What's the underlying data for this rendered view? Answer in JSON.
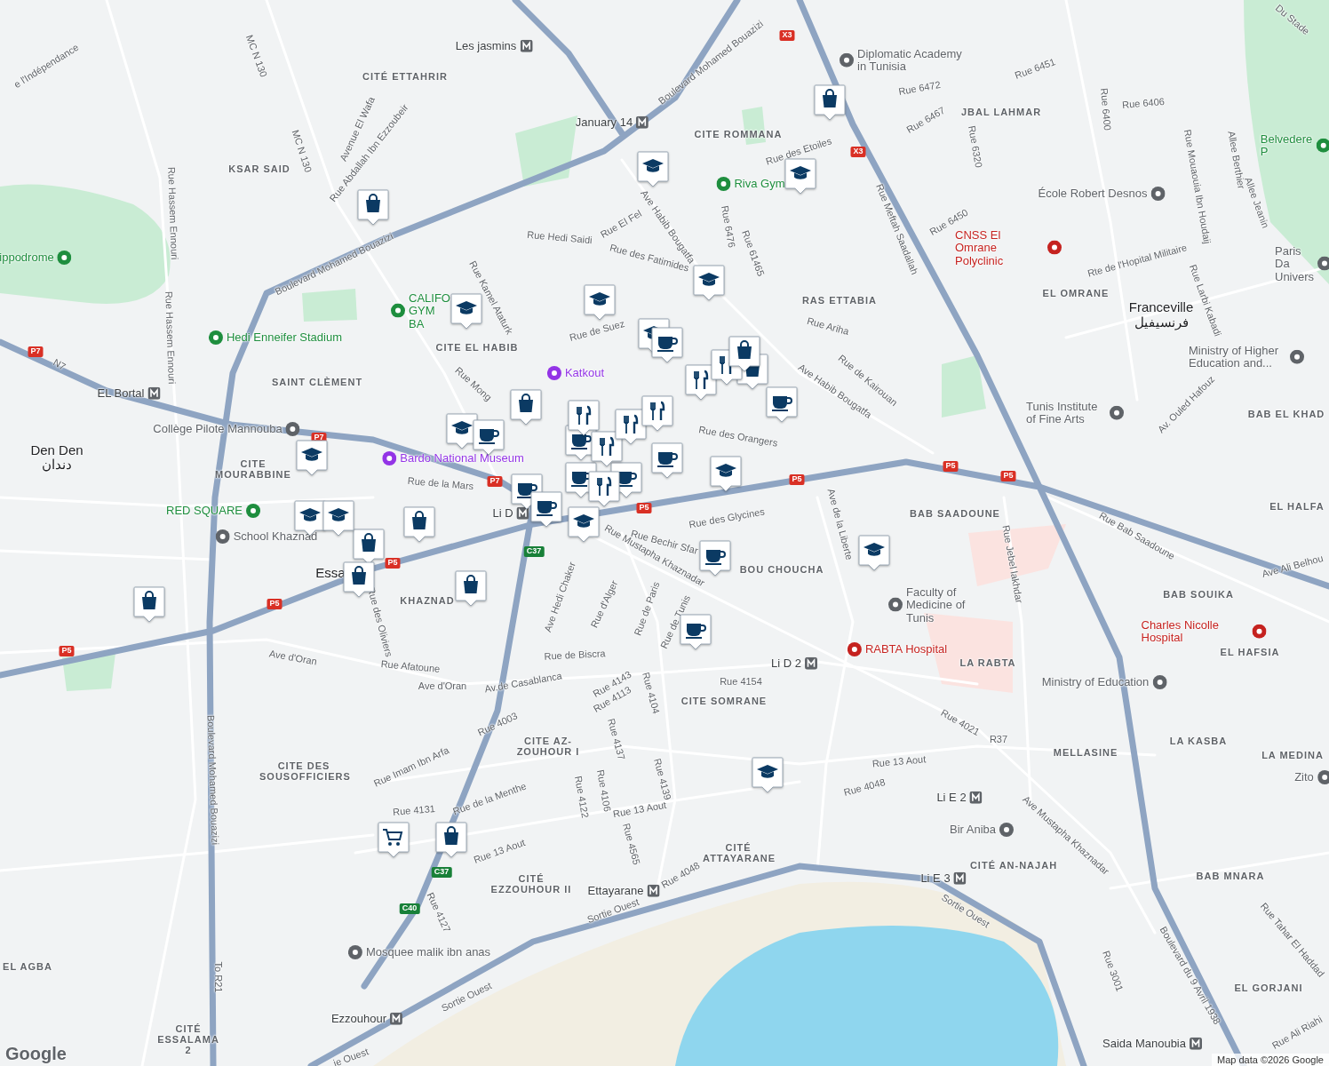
{
  "map": {
    "labels": [
      {
        "text": "Les jasmins",
        "kind": "transit"
      },
      {
        "text": "CITÉ ETTAHRIR",
        "kind": "area"
      },
      {
        "text": "KSAR SAID",
        "kind": "area"
      },
      {
        "text": "January 14",
        "kind": "transit"
      },
      {
        "text": "Diplomatic Academy in Tunisia",
        "kind": "poi",
        "color": "#5f6368"
      },
      {
        "text": "CITE ROMMANA",
        "kind": "area"
      },
      {
        "text": "JBAL LAHMAR",
        "kind": "area"
      },
      {
        "text": "Riva Gym",
        "kind": "poi",
        "color": "#1e8e3e"
      },
      {
        "text": "École Robert Desnos",
        "kind": "poi",
        "color": "#5f6368"
      },
      {
        "text": "CNSS El Omrane Polyclinic",
        "kind": "poi",
        "color": "#c5221f"
      },
      {
        "text": "Belvedere P",
        "kind": "poi",
        "color": "#1e8e3e"
      },
      {
        "text": "ippodrome",
        "kind": "poi",
        "color": "#1e8e3e"
      },
      {
        "text": "Paris Da Univers",
        "kind": "poi",
        "color": "#5f6368"
      },
      {
        "text": "CALIFO GYM BA",
        "kind": "poi",
        "color": "#1e8e3e"
      },
      {
        "text": "Hedi Enneifer Stadium",
        "kind": "poi",
        "color": "#1e8e3e"
      },
      {
        "text": "RAS ETTABIA",
        "kind": "area"
      },
      {
        "text": "EL OMRANE",
        "kind": "area"
      },
      {
        "text": "Franceville",
        "kind": "place"
      },
      {
        "text": "فرنسيفيل",
        "kind": "place"
      },
      {
        "text": "CITE EL HABIB",
        "kind": "area"
      },
      {
        "text": "Katkout",
        "kind": "poi",
        "color": "#9334e6"
      },
      {
        "text": "SAINT CLÈMENT",
        "kind": "area"
      },
      {
        "text": "EL Bortal",
        "kind": "transit"
      },
      {
        "text": "Ministry of Higher Education and...",
        "kind": "poi",
        "color": "#5f6368"
      },
      {
        "text": "Tunis Institute of Fine Arts",
        "kind": "poi",
        "color": "#5f6368"
      },
      {
        "text": "BAB EL KHAD",
        "kind": "area"
      },
      {
        "text": "Collège Pilote Mannouba",
        "kind": "poi",
        "color": "#5f6368"
      },
      {
        "text": "Den Den",
        "kind": "place"
      },
      {
        "text": "دندان",
        "kind": "place"
      },
      {
        "text": "CITE MOURABBINE",
        "kind": "area"
      },
      {
        "text": "Bardo National Museum",
        "kind": "poi",
        "color": "#9334e6"
      },
      {
        "text": "RED SQUARE",
        "kind": "poi",
        "color": "#1e8e3e"
      },
      {
        "text": "Li D",
        "kind": "transit"
      },
      {
        "text": "School Khaznad",
        "kind": "poi",
        "color": "#5f6368"
      },
      {
        "text": "BAB SAADOUNE",
        "kind": "area"
      },
      {
        "text": "EL HALFA",
        "kind": "area"
      },
      {
        "text": "BOU CHOUCHA",
        "kind": "area"
      },
      {
        "text": "KHAZNAD",
        "kind": "area"
      },
      {
        "text": "BAB SOUIKA",
        "kind": "area"
      },
      {
        "text": "Faculty of Medicine of Tunis",
        "kind": "poi",
        "color": "#5f6368"
      },
      {
        "text": "Charles Nicolle Hospital",
        "kind": "poi",
        "color": "#c5221f"
      },
      {
        "text": "RABTA Hospital",
        "kind": "poi",
        "color": "#c5221f"
      },
      {
        "text": "EL HAFSIA",
        "kind": "area"
      },
      {
        "text": "LA RABTA",
        "kind": "area"
      },
      {
        "text": "Li D 2",
        "kind": "transit"
      },
      {
        "text": "Ministry of Education",
        "kind": "poi",
        "color": "#5f6368"
      },
      {
        "text": "CITE SOMRANE",
        "kind": "area"
      },
      {
        "text": "CITE AZ-ZOUHOUR I",
        "kind": "area"
      },
      {
        "text": "LA KASBA",
        "kind": "area"
      },
      {
        "text": "MELLASINE",
        "kind": "area"
      },
      {
        "text": "LA MEDINA",
        "kind": "area"
      },
      {
        "text": "CITE DES SOUSOFFICIERS",
        "kind": "area"
      },
      {
        "text": "Zito",
        "kind": "poi",
        "color": "#5f6368"
      },
      {
        "text": "Li E 2",
        "kind": "transit"
      },
      {
        "text": "Bir Aniba",
        "kind": "poi",
        "color": "#5f6368"
      },
      {
        "text": "CITÉ EZZOUHOUR II",
        "kind": "area"
      },
      {
        "text": "Ettayarane",
        "kind": "transit"
      },
      {
        "text": "CITÉ ATTAYARANE",
        "kind": "area"
      },
      {
        "text": "Li E 3",
        "kind": "transit"
      },
      {
        "text": "CITÉ AN-NAJAH",
        "kind": "area"
      },
      {
        "text": "BAB MNARA",
        "kind": "area"
      },
      {
        "text": "Mosquee malik ibn anas",
        "kind": "poi",
        "color": "#5f6368"
      },
      {
        "text": "EL AGBA",
        "kind": "area"
      },
      {
        "text": "EL GORJANI",
        "kind": "area"
      },
      {
        "text": "Ezzouhour",
        "kind": "transit"
      },
      {
        "text": "CITÉ ESSALAMA 2",
        "kind": "area"
      },
      {
        "text": "Saida Manoubia",
        "kind": "transit"
      },
      {
        "text": "Boulevard Mohamed Bouazizi",
        "kind": "street"
      },
      {
        "text": "Boulevard Mohamed Bouazizi",
        "kind": "street"
      },
      {
        "text": "Boulevard Mohamed Bouazizi",
        "kind": "street"
      },
      {
        "text": "MC N 130",
        "kind": "street"
      },
      {
        "text": "MC N 130",
        "kind": "street"
      },
      {
        "text": "e l'Indépendance",
        "kind": "street"
      },
      {
        "text": "Rue Abdallah Ibn Ezzoubeir",
        "kind": "street"
      },
      {
        "text": "Avenue El Wafa",
        "kind": "street"
      },
      {
        "text": "Rue Hassem Ennouri",
        "kind": "street"
      },
      {
        "text": "Rue Hassem Ennouri",
        "kind": "street"
      },
      {
        "text": "Rue Hedi Saidi",
        "kind": "street"
      },
      {
        "text": "Rue El Fel",
        "kind": "street"
      },
      {
        "text": "Ave Habib Bougatfa",
        "kind": "street"
      },
      {
        "text": "Rue des Fatimides",
        "kind": "street"
      },
      {
        "text": "Rue Kamel Ataturk",
        "kind": "street"
      },
      {
        "text": "Rue de Suez",
        "kind": "street"
      },
      {
        "text": "Rue des Etoiles",
        "kind": "street"
      },
      {
        "text": "Rue Meftah Saadallah",
        "kind": "street"
      },
      {
        "text": "Rue 6476",
        "kind": "street"
      },
      {
        "text": "Rue 61465",
        "kind": "street"
      },
      {
        "text": "Rue Ariha",
        "kind": "street"
      },
      {
        "text": "Ave Habib Bougatfa",
        "kind": "street"
      },
      {
        "text": "Rue de Kairouan",
        "kind": "street"
      },
      {
        "text": "Rue des Orangers",
        "kind": "street"
      },
      {
        "text": "Rue Mong",
        "kind": "street"
      },
      {
        "text": "Rue de la Mars",
        "kind": "street"
      },
      {
        "text": "Rue des Glycines",
        "kind": "street"
      },
      {
        "text": "Rue Bechir Sfar",
        "kind": "street"
      },
      {
        "text": "Rue Mustapha Khaznadar",
        "kind": "street"
      },
      {
        "text": "Ave de la Liberte",
        "kind": "street"
      },
      {
        "text": "Ave Hedi Chaker",
        "kind": "street"
      },
      {
        "text": "Rue d'Alger",
        "kind": "street"
      },
      {
        "text": "Rue de Paris",
        "kind": "street"
      },
      {
        "text": "Rue de Tunis",
        "kind": "street"
      },
      {
        "text": "Rue Jebel lakhdar",
        "kind": "street"
      },
      {
        "text": "Rue Bab Saadoune",
        "kind": "street"
      },
      {
        "text": "Av. Ouled Hafouz",
        "kind": "street"
      },
      {
        "text": "Ave Ali Belhou",
        "kind": "street"
      },
      {
        "text": "Rue 6472",
        "kind": "street"
      },
      {
        "text": "Rue 6467",
        "kind": "street"
      },
      {
        "text": "Rue 6451",
        "kind": "street"
      },
      {
        "text": "Rue 6406",
        "kind": "street"
      },
      {
        "text": "Rue 6400",
        "kind": "street"
      },
      {
        "text": "Rue 6320",
        "kind": "street"
      },
      {
        "text": "Rue 6450",
        "kind": "street"
      },
      {
        "text": "Rte de l'Hopital Militaire",
        "kind": "street"
      },
      {
        "text": "Rue Mouaouia Ibn Houdaij",
        "kind": "street"
      },
      {
        "text": "Rue Larbi Kabadi",
        "kind": "street"
      },
      {
        "text": "Allee Berthier",
        "kind": "street"
      },
      {
        "text": "Allee Jeanin",
        "kind": "street"
      },
      {
        "text": "Du Stade",
        "kind": "street"
      },
      {
        "text": "Ave d'Oran",
        "kind": "street"
      },
      {
        "text": "Ave d'Oran",
        "kind": "street"
      },
      {
        "text": "Rue Afatoune",
        "kind": "street"
      },
      {
        "text": "Av.de Casablanca",
        "kind": "street"
      },
      {
        "text": "Rue de Biscra",
        "kind": "street"
      },
      {
        "text": "Rue des Oliviers",
        "kind": "street"
      },
      {
        "text": "Rue 4154",
        "kind": "street"
      },
      {
        "text": "Rue 4143",
        "kind": "street"
      },
      {
        "text": "Rue 4113",
        "kind": "street"
      },
      {
        "text": "Rue 4104",
        "kind": "street"
      },
      {
        "text": "Rue 4137",
        "kind": "street"
      },
      {
        "text": "Rue 4139",
        "kind": "street"
      },
      {
        "text": "Rue 4003",
        "kind": "street"
      },
      {
        "text": "Rue Imam Ibn Arfa",
        "kind": "street"
      },
      {
        "text": "Rue de la Menthe",
        "kind": "street"
      },
      {
        "text": "Rue 4131",
        "kind": "street"
      },
      {
        "text": "Rue 4122",
        "kind": "street"
      },
      {
        "text": "Rue 4106",
        "kind": "street"
      },
      {
        "text": "Rue 4565",
        "kind": "street"
      },
      {
        "text": "Rue 13 Aout",
        "kind": "street"
      },
      {
        "text": "Rue 13 Aout",
        "kind": "street"
      },
      {
        "text": "Rue 13 Aout",
        "kind": "street"
      },
      {
        "text": "Rue 4048",
        "kind": "street"
      },
      {
        "text": "Rue 4048",
        "kind": "street"
      },
      {
        "text": "Rue 4021",
        "kind": "street"
      },
      {
        "text": "R37",
        "kind": "street"
      },
      {
        "text": "Ave Mustapha Khaznadar",
        "kind": "street"
      },
      {
        "text": "Rue 4127",
        "kind": "street"
      },
      {
        "text": "Sortie Ouest",
        "kind": "street"
      },
      {
        "text": "Sortie Ouest",
        "kind": "street"
      },
      {
        "text": "Sortie Ouest",
        "kind": "street"
      },
      {
        "text": "ie Ouest",
        "kind": "street"
      },
      {
        "text": "Boulevard du 9 Avril 1938",
        "kind": "street"
      },
      {
        "text": "Rue 3001",
        "kind": "street"
      },
      {
        "text": "Rue Tahar El Haddad",
        "kind": "street"
      },
      {
        "text": "Rue Ali Riahi",
        "kind": "street"
      },
      {
        "text": "To R21",
        "kind": "street"
      },
      {
        "text": "P7",
        "kind": "shield",
        "color": "#d93025"
      },
      {
        "text": "N7",
        "kind": "street"
      },
      {
        "text": "P7",
        "kind": "shield",
        "color": "#d93025"
      },
      {
        "text": "P7",
        "kind": "shield",
        "color": "#d93025"
      },
      {
        "text": "P5",
        "kind": "shield",
        "color": "#d93025"
      },
      {
        "text": "P5",
        "kind": "shield",
        "color": "#d93025"
      },
      {
        "text": "P5",
        "kind": "shield",
        "color": "#d93025"
      },
      {
        "text": "P5",
        "kind": "shield",
        "color": "#d93025"
      },
      {
        "text": "P5",
        "kind": "shield",
        "color": "#d93025"
      },
      {
        "text": "P5",
        "kind": "shield",
        "color": "#d93025"
      },
      {
        "text": "P5",
        "kind": "shield",
        "color": "#d93025"
      },
      {
        "text": "C37",
        "kind": "shield",
        "color": "#188038"
      },
      {
        "text": "C37",
        "kind": "shield",
        "color": "#188038"
      },
      {
        "text": "C40",
        "kind": "shield",
        "color": "#188038"
      },
      {
        "text": "X3",
        "kind": "shield",
        "color": "#d93025"
      },
      {
        "text": "X3",
        "kind": "shield",
        "color": "#d93025"
      },
      {
        "text": "Essa",
        "kind": "place"
      }
    ],
    "markers": [
      {
        "kind": "shop"
      },
      {
        "kind": "shop"
      },
      {
        "kind": "shop"
      },
      {
        "kind": "shop"
      },
      {
        "kind": "shop"
      },
      {
        "kind": "shop"
      },
      {
        "kind": "shop"
      },
      {
        "kind": "shop"
      },
      {
        "kind": "shop"
      },
      {
        "kind": "shop"
      },
      {
        "kind": "school"
      },
      {
        "kind": "school"
      },
      {
        "kind": "school"
      },
      {
        "kind": "school"
      },
      {
        "kind": "school"
      },
      {
        "kind": "school"
      },
      {
        "kind": "school"
      },
      {
        "kind": "school"
      },
      {
        "kind": "school"
      },
      {
        "kind": "school"
      },
      {
        "kind": "school"
      },
      {
        "kind": "school"
      },
      {
        "kind": "school"
      },
      {
        "kind": "school"
      },
      {
        "kind": "cafe"
      },
      {
        "kind": "cafe"
      },
      {
        "kind": "cafe"
      },
      {
        "kind": "cafe"
      },
      {
        "kind": "cafe"
      },
      {
        "kind": "cafe"
      },
      {
        "kind": "cafe"
      },
      {
        "kind": "cafe"
      },
      {
        "kind": "cafe"
      },
      {
        "kind": "cafe"
      },
      {
        "kind": "cafe"
      },
      {
        "kind": "restaurant"
      },
      {
        "kind": "restaurant"
      },
      {
        "kind": "restaurant"
      },
      {
        "kind": "restaurant"
      },
      {
        "kind": "restaurant"
      },
      {
        "kind": "restaurant"
      },
      {
        "kind": "restaurant"
      },
      {
        "kind": "shop"
      },
      {
        "kind": "grocery"
      }
    ]
  },
  "logo": "Google",
  "attribution": "Map data ©2026 Google"
}
